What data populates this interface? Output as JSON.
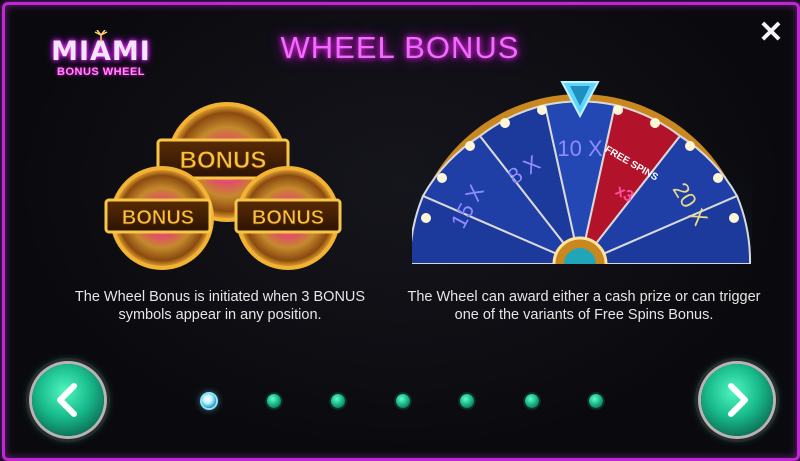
{
  "header": {
    "logo_line1": "MIAMI",
    "logo_line2": "BONUS WHEEL",
    "title": "WHEEL BONUS",
    "close_icon": "close-icon"
  },
  "left_panel": {
    "symbol_label": "BONUS",
    "description": "The Wheel Bonus is initiated when 3 BONUS symbols appear in any position."
  },
  "right_panel": {
    "wheel_segments": [
      "15 X",
      "8 X",
      "10 X",
      "FREE SPINS x3",
      "20 X"
    ],
    "free_spins_label": "FREE SPINS",
    "free_spins_multiplier": "x3",
    "description": "The Wheel can award either a cash prize or can trigger one of the variants of Free Spins Bonus."
  },
  "navigation": {
    "prev_icon": "chevron-left-icon",
    "next_icon": "chevron-right-icon",
    "page_count": 7,
    "current_page": 1
  },
  "colors": {
    "frame": "#c026d3",
    "title": "#f06bff",
    "wheel_blue": "#1f3fa6",
    "wheel_red": "#b3122b",
    "gold": "#f2b233",
    "teal_button": "#17b889"
  }
}
